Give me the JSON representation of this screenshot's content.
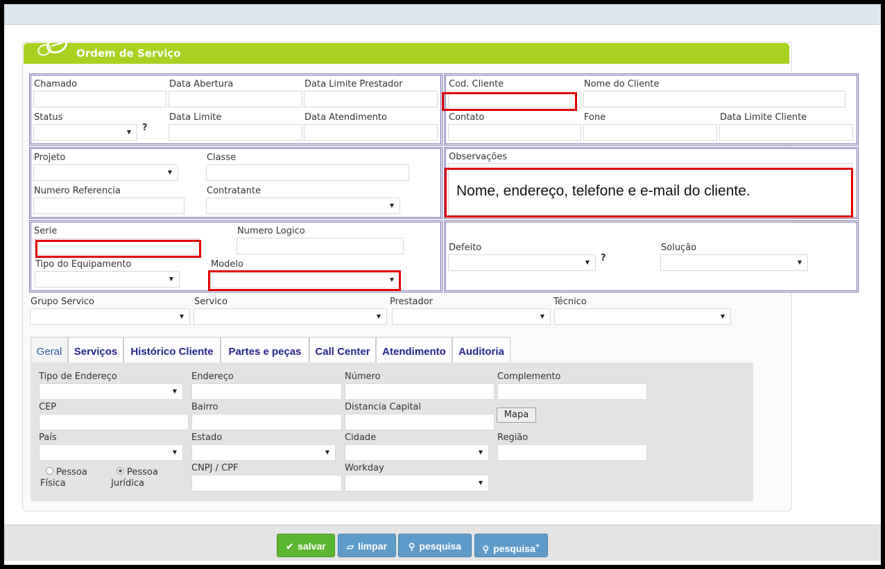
{
  "header": {
    "title": "Ordem de Serviço"
  },
  "block1": {
    "chamado": "Chamado",
    "data_abertura": "Data Abertura",
    "data_limite_prestador": "Data Limite Prestador",
    "status": "Status",
    "data_limite": "Data Limite",
    "data_atendimento": "Data Atendimento",
    "help": "?"
  },
  "block2": {
    "cod_cliente": "Cod. Cliente",
    "nome_cliente": "Nome do Cliente",
    "contato": "Contato",
    "fone": "Fone",
    "data_limite_cliente": "Data Limite Cliente"
  },
  "block3": {
    "projeto": "Projeto",
    "classe": "Classe",
    "numero_referencia": "Numero Referencia",
    "contratante": "Contratante"
  },
  "block4": {
    "observacoes": "Observações",
    "annotation": "Nome, endereço, telefone e e-mail do cliente."
  },
  "block5": {
    "serie": "Serie",
    "numero_logico": "Numero Logico",
    "tipo_equipamento": "Tipo do Equipamento",
    "modelo": "Modelo"
  },
  "block6": {
    "defeito": "Defeito",
    "solucao": "Solução",
    "help": "?"
  },
  "row_service": {
    "grupo_servico": "Grupo Servico",
    "servico": "Servico",
    "prestador": "Prestador",
    "tecnico": "Técnico"
  },
  "tabs": [
    {
      "label": "Geral"
    },
    {
      "label": "Serviços"
    },
    {
      "label": "Histórico Cliente"
    },
    {
      "label": "Partes e peças"
    },
    {
      "label": "Call Center"
    },
    {
      "label": "Atendimento"
    },
    {
      "label": "Auditoria"
    }
  ],
  "geral": {
    "tipo_endereco": "Tipo de Endereço",
    "endereco": "Endereço",
    "numero": "Número",
    "complemento": "Complemento",
    "cep": "CEP",
    "bairro": "Bairro",
    "distancia_capital": "Distancia Capital",
    "mapa": "Mapa",
    "pais": "País",
    "estado": "Estado",
    "cidade": "Cidade",
    "regiao": "Região",
    "pessoa_fisica_1": "Pessoa",
    "pessoa_fisica_2": "Física",
    "pessoa_juridica_1": "Pessoa",
    "pessoa_juridica_2": "Jurídica",
    "cnpj_cpf": "CNPJ / CPF",
    "workday": "Workday"
  },
  "footer": {
    "salvar": "salvar",
    "limpar": "limpar",
    "pesquisa": "pesquisa",
    "pesquisa_plus": "pesquisa"
  },
  "colors": {
    "header_green": "#a9d220",
    "annotation_red": "#e00000",
    "fieldset_border": "#7a73b0",
    "save_green": "#5bb632",
    "button_blue": "#5e9bc9"
  }
}
